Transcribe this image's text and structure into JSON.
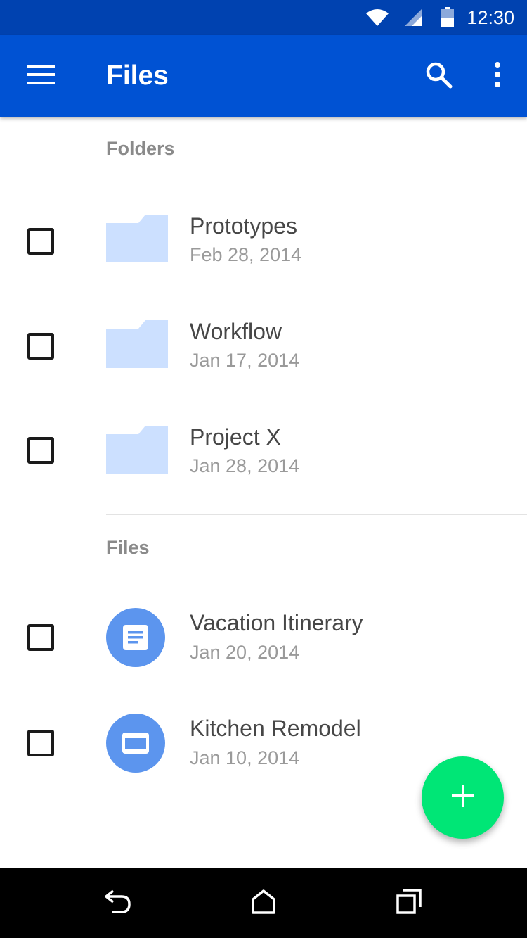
{
  "status_bar": {
    "time": "12:30",
    "icons": [
      "wifi-icon",
      "signal-icon",
      "battery-icon"
    ]
  },
  "app_bar": {
    "title": "Files",
    "icons": [
      "menu-icon",
      "search-icon",
      "more-vert-icon"
    ]
  },
  "folders_section": {
    "header": "Folders",
    "items": [
      {
        "name": "Prototypes",
        "date": "Feb 28, 2014",
        "icon": "folder-icon"
      },
      {
        "name": "Workflow",
        "date": "Jan 17, 2014",
        "icon": "folder-icon"
      },
      {
        "name": "Project X",
        "date": "Jan 28, 2014",
        "icon": "folder-icon"
      }
    ]
  },
  "files_section": {
    "header": "Files",
    "items": [
      {
        "name": "Vacation Itinerary",
        "date": "Jan 20, 2014",
        "icon": "document-icon"
      },
      {
        "name": "Kitchen Remodel",
        "date": "Jan 10, 2014",
        "icon": "presentation-icon"
      }
    ]
  },
  "fab": {
    "icon": "add-icon"
  },
  "nav_bar": {
    "icons": [
      "back-icon",
      "home-icon",
      "recents-icon"
    ]
  },
  "colors": {
    "status_bar": "#0042B0",
    "app_bar": "#0052D3",
    "folder": "#CCE0FF",
    "file_circle": "#5C95EE",
    "fab": "#00E676",
    "nav_bar": "#000000"
  }
}
